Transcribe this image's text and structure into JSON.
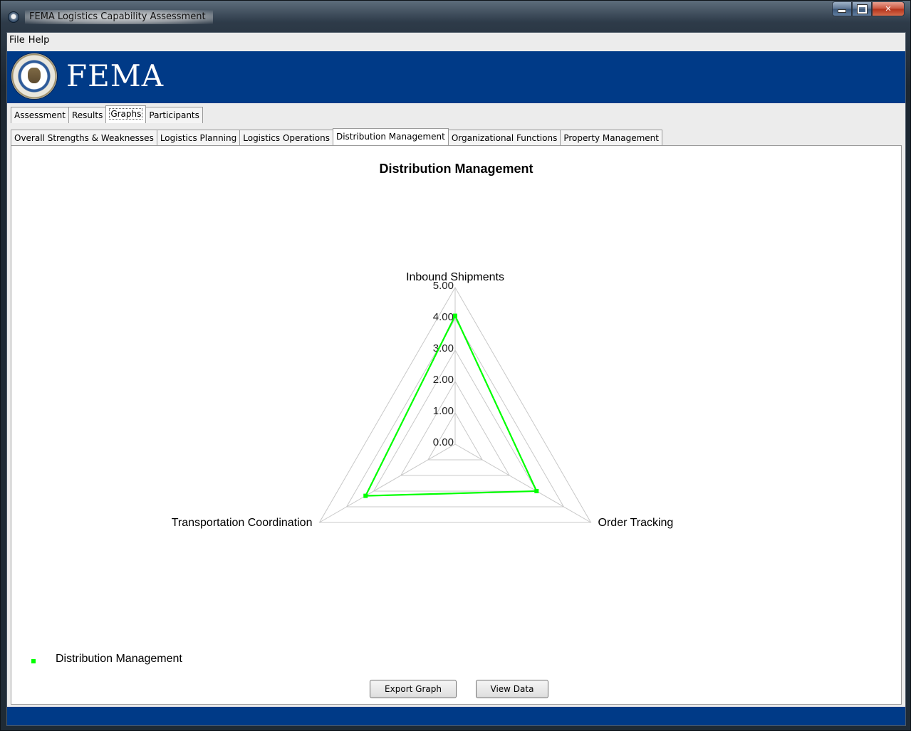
{
  "window": {
    "title": "FEMA Logistics Capability Assessment"
  },
  "menu": {
    "items": [
      "File",
      "Help"
    ]
  },
  "banner": {
    "brand_text": "FEMA",
    "seal_text": "U.S. DEPARTMENT OF HOMELAND SECURITY"
  },
  "main_tabs": [
    {
      "label": "Assessment",
      "active": false
    },
    {
      "label": "Results",
      "active": false
    },
    {
      "label": "Graphs",
      "active": true
    },
    {
      "label": "Participants",
      "active": false
    }
  ],
  "sub_tabs": [
    {
      "label": "Overall Strengths & Weaknesses",
      "active": false
    },
    {
      "label": "Logistics Planning",
      "active": false
    },
    {
      "label": "Logistics Operations",
      "active": false
    },
    {
      "label": "Distribution Management",
      "active": true
    },
    {
      "label": "Organizational Functions",
      "active": false
    },
    {
      "label": "Property Management",
      "active": false
    }
  ],
  "buttons": {
    "export": "Export Graph",
    "view": "View Data"
  },
  "colors": {
    "series": "#00ff00",
    "banner": "#003a87",
    "grid": "#c8c8c8"
  },
  "chart_data": {
    "type": "radar",
    "title": "Distribution Management",
    "axes": [
      "Inbound Shipments",
      "Order Tracking",
      "Transportation Coordination"
    ],
    "ticks": [
      "0.00",
      "1.00",
      "2.00",
      "3.00",
      "4.00",
      "5.00"
    ],
    "range": [
      0,
      5
    ],
    "series": [
      {
        "name": "Distribution Management",
        "values": [
          4.1,
          3.0,
          3.3
        ]
      }
    ],
    "legend": "bottom-left"
  }
}
